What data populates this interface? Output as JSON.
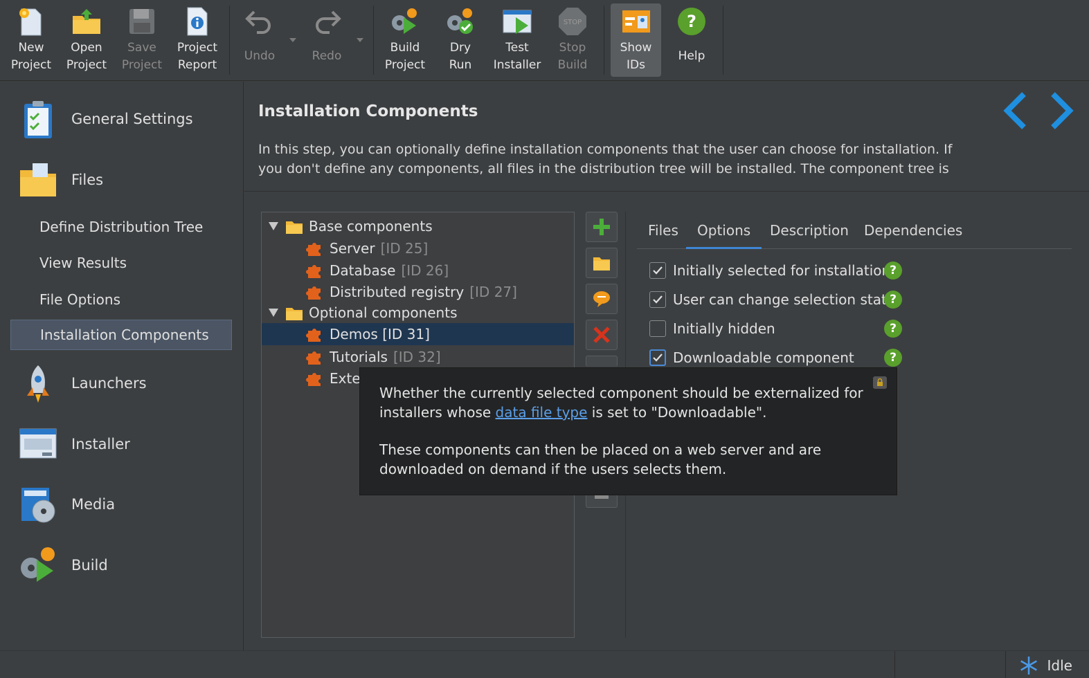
{
  "toolbar": {
    "new_project": [
      "New",
      "Project"
    ],
    "open_project": [
      "Open",
      "Project"
    ],
    "save_project": [
      "Save",
      "Project"
    ],
    "project_report": [
      "Project",
      "Report"
    ],
    "undo": "Undo",
    "redo": "Redo",
    "build_project": [
      "Build",
      "Project"
    ],
    "dry_run": [
      "Dry",
      "Run"
    ],
    "test_installer": [
      "Test",
      "Installer"
    ],
    "stop_build": [
      "Stop",
      "Build"
    ],
    "show_ids": [
      "Show",
      "IDs"
    ],
    "help": "Help",
    "stop_icon_text": "STOP"
  },
  "sidebar": {
    "general_settings": "General Settings",
    "files": "Files",
    "define_distribution_tree": "Define Distribution Tree",
    "view_results": "View Results",
    "file_options": "File Options",
    "installation_components": "Installation Components",
    "launchers": "Launchers",
    "installer": "Installer",
    "media": "Media",
    "build": "Build"
  },
  "main": {
    "title": "Installation Components",
    "description": "In this step, you can optionally define installation components that the user can choose for installation. If you don't define any components, all files in the distribution tree will be installed. The component tree is"
  },
  "tree": {
    "base_components": "Base components",
    "server": "Server",
    "server_id": "[ID 25]",
    "database": "Database",
    "database_id": "[ID 26]",
    "distributed_registry": "Distributed registry",
    "distributed_registry_id": "[ID 27]",
    "optional_components": "Optional components",
    "demos": "Demos [ID 31]",
    "tutorials": "Tutorials",
    "tutorials_id": "[ID 32]",
    "external_partial": "Exter"
  },
  "tabs": {
    "files": "Files",
    "options": "Options",
    "description": "Description",
    "dependencies": "Dependencies"
  },
  "options": {
    "initially_selected": {
      "label": "Initially selected for installation",
      "checked": true
    },
    "user_can_change": {
      "label": "User can change selection state",
      "checked": true
    },
    "initially_hidden": {
      "label": "Initially hidden",
      "checked": false
    },
    "downloadable": {
      "label": "Downloadable component",
      "checked": true
    },
    "help_glyph": "?"
  },
  "tooltip": {
    "para1_before": "Whether the currently selected component should be externalized for installers whose ",
    "para1_link": "data file type",
    "para1_after": " is set to \"Downloadable\".",
    "para2": "These components can then be placed on a web server and are downloaded on demand if the users selects them."
  },
  "status": {
    "state": "Idle"
  },
  "colors": {
    "accent": "#3e86d6",
    "help_green": "#5aa02c",
    "selection": "#1f3650",
    "link": "#5b9fe8"
  }
}
